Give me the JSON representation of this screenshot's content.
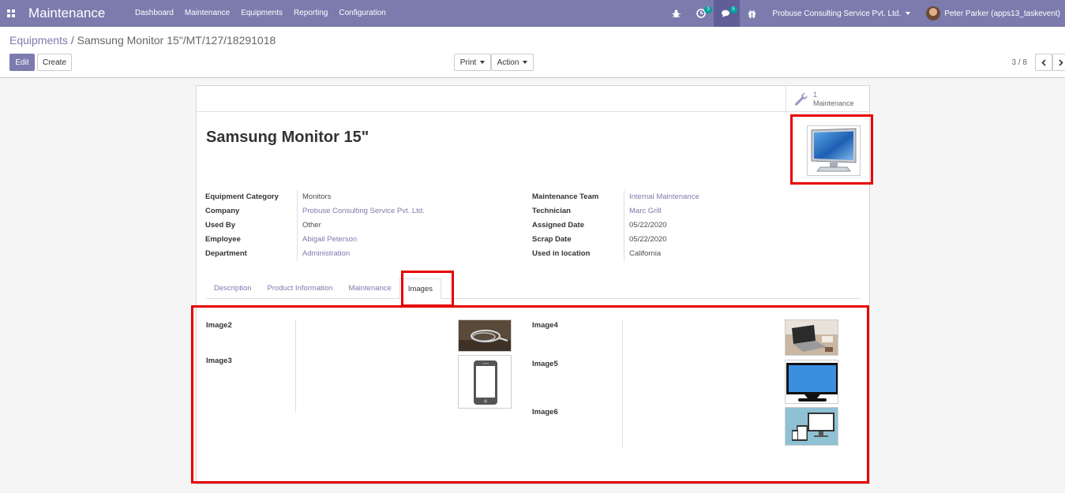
{
  "navbar": {
    "app_title": "Maintenance",
    "menu": [
      "Dashboard",
      "Maintenance",
      "Equipments",
      "Reporting",
      "Configuration"
    ],
    "activity_badge": "3",
    "messages_badge": "5",
    "company": "Probuse Consulting Service Pvt. Ltd.",
    "user": "Peter Parker (apps13_taskevent)",
    "color": "#7c7bad"
  },
  "breadcrumb": {
    "parent": "Equipments",
    "separator": " / ",
    "current": "Samsung Monitor 15\"/MT/127/18291018"
  },
  "toolbar": {
    "edit": "Edit",
    "create": "Create",
    "print": "Print",
    "action": "Action"
  },
  "pager": {
    "value": "3 / 8"
  },
  "stat_button": {
    "count": "1",
    "label": "Maintenance"
  },
  "record": {
    "name": "Samsung Monitor 15\"",
    "left_fields": [
      {
        "label": "Equipment Category",
        "value": "Monitors",
        "link": false
      },
      {
        "label": "Company",
        "value": "Probuse Consulting Service Pvt. Ltd.",
        "link": true
      },
      {
        "label": "Used By",
        "value": "Other",
        "link": false
      },
      {
        "label": "Employee",
        "value": "Abigail Peterson",
        "link": true
      },
      {
        "label": "Department",
        "value": "Administration",
        "link": true
      }
    ],
    "right_fields": [
      {
        "label": "Maintenance Team",
        "value": "Internal Maintenance",
        "link": true
      },
      {
        "label": "Technician",
        "value": "Marc Grill",
        "link": true
      },
      {
        "label": "Assigned Date",
        "value": "05/22/2020",
        "link": false
      },
      {
        "label": "Scrap Date",
        "value": "05/22/2020",
        "link": false
      },
      {
        "label": "Used in location",
        "value": "California",
        "link": false
      }
    ]
  },
  "tabs": [
    "Description",
    "Product Information",
    "Maintenance",
    "Images"
  ],
  "active_tab": "Images",
  "images": {
    "image2": "Image2",
    "image3": "Image3",
    "image4": "Image4",
    "image5": "Image5",
    "image6": "Image6"
  },
  "highlight_color": "#e60000"
}
